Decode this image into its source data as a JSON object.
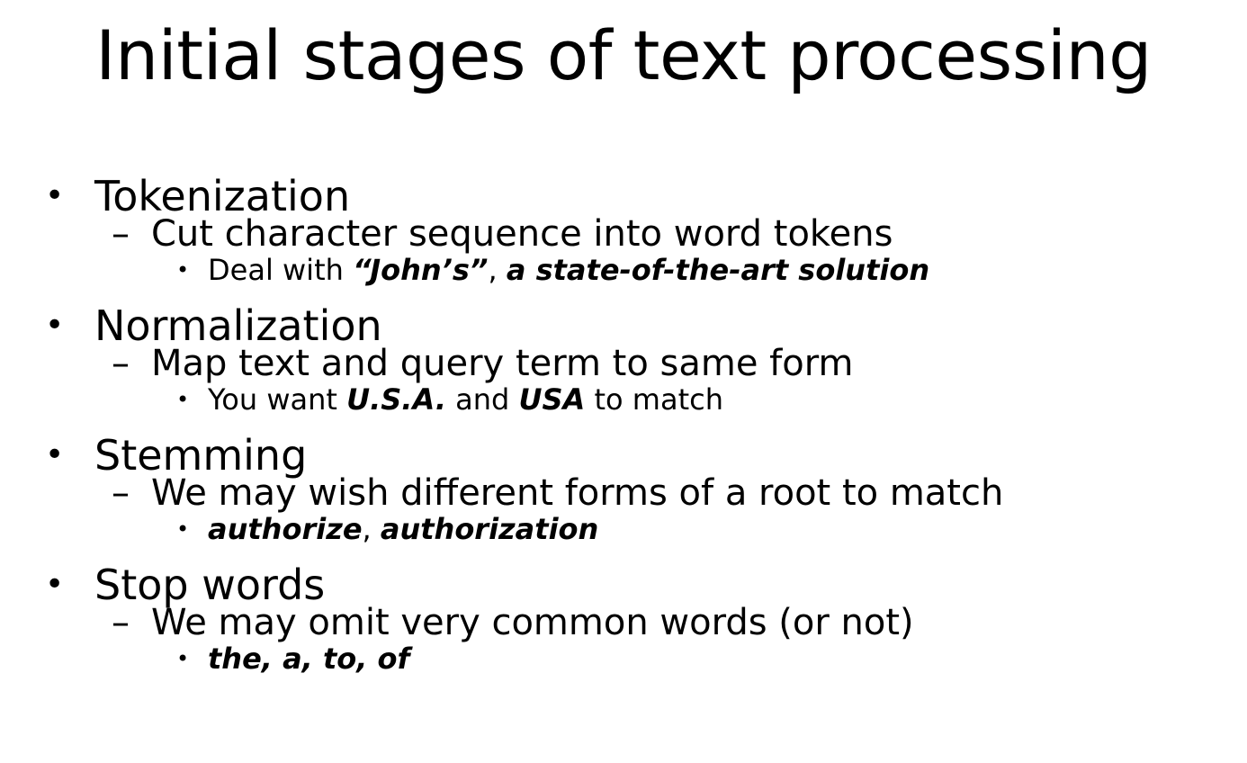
{
  "title": "Initial stages of text processing",
  "items": [
    {
      "heading": "Tokenization",
      "sub": "Cut character sequence into word tokens",
      "detail": {
        "prefix": "Deal with ",
        "em1": "“John’s”",
        "sep": ", ",
        "em2": "a state-of-the-art solution"
      }
    },
    {
      "heading": "Normalization",
      "sub": "Map text and query term to same form",
      "detail": {
        "prefix": "You want ",
        "em1": "U.S.A.",
        "mid": " and ",
        "em2": "USA",
        "suffix": " to match"
      }
    },
    {
      "heading": "Stemming",
      "sub": "We may wish different forms of a root to match",
      "detail": {
        "em1": "authorize",
        "sep": ", ",
        "em2": "authorization"
      }
    },
    {
      "heading": "Stop words",
      "sub": "We may omit very common words (or not)",
      "detail": {
        "em1": "the, a, to, of"
      }
    }
  ],
  "symbols": {
    "bullet": "•",
    "dash": "–"
  }
}
